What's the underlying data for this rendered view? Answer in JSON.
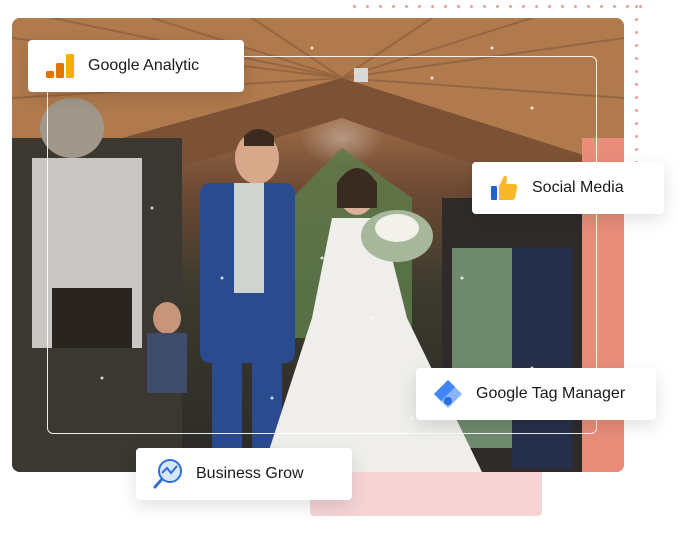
{
  "cards": {
    "google_analytic": {
      "label": "Google Analytic",
      "icon": "google-analytics-icon"
    },
    "social_media": {
      "label": "Social Media",
      "icon": "thumbs-up-icon"
    },
    "google_tag_manager": {
      "label": "Google Tag Manager",
      "icon": "google-tag-manager-icon"
    },
    "business_grow": {
      "label": "Business Grow",
      "icon": "magnifier-growth-icon"
    }
  },
  "photo": {
    "subject": "wedding-photo",
    "icon": "wedding-photo"
  },
  "colors": {
    "accent_pink": "#f6d4d6",
    "dots": "#ef9a9a",
    "ga_orange": "#f9ab00",
    "gtm_blue": "#4285f4"
  }
}
